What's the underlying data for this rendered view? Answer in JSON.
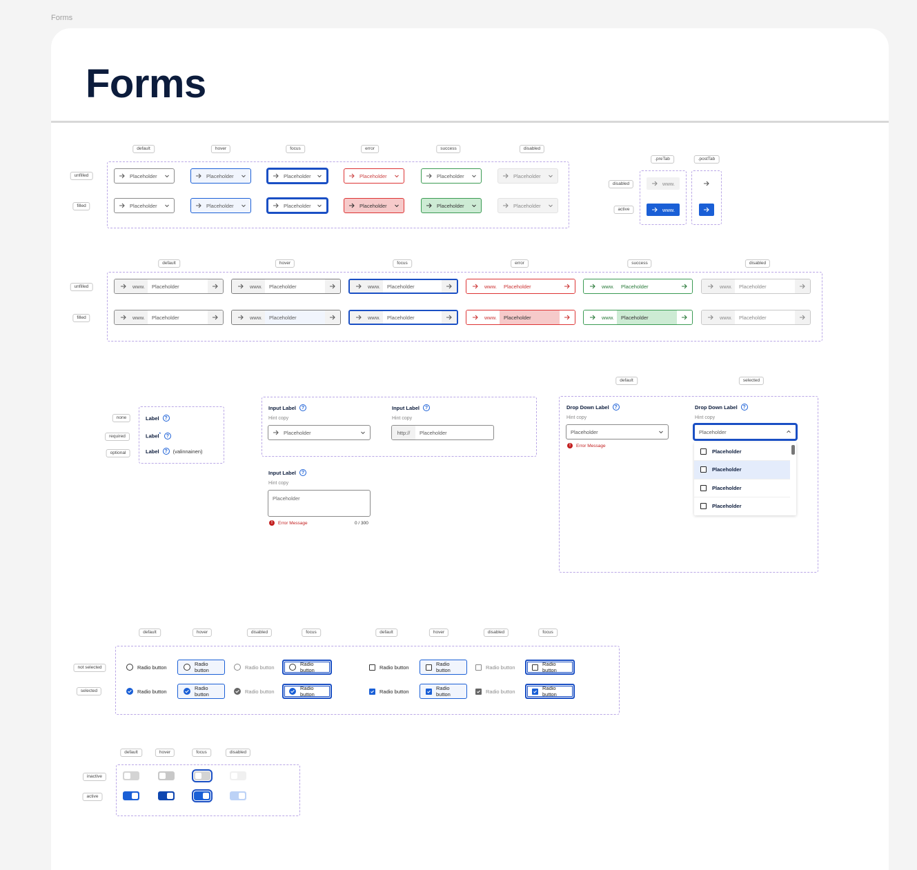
{
  "frame_label": "Forms",
  "page_title": "Forms",
  "state_tags": [
    "default",
    "hover",
    "focus",
    "error",
    "success",
    "disabled"
  ],
  "fill_tags": [
    "unfilled",
    "filled"
  ],
  "placeholder": "Placeholder",
  "url_prefix": "www.",
  "http_prefix": "http://",
  "tab_section": {
    "pre_tab": ".preTab",
    "post_tab": ".postTab",
    "disabled": "disabled",
    "active": "active"
  },
  "label_section": {
    "tags": [
      "none",
      "required",
      "optional"
    ],
    "label": "Label",
    "required_mark": "*",
    "optional_text": "(valinnainen)"
  },
  "inputs": {
    "input_label": "Input Label",
    "hint": "Hint copy",
    "error_message": "Error Message",
    "counter": "0 / 300"
  },
  "dropdown": {
    "tags": [
      "default",
      "selected"
    ],
    "label": "Drop Down Label",
    "hint": "Hint copy",
    "error_message": "Error Message",
    "options": [
      "Placeholder",
      "Placeholder",
      "Placeholder",
      "Placeholder"
    ]
  },
  "radio_section": {
    "tags": [
      "default",
      "hover",
      "disabled",
      "focus"
    ],
    "row_tags": [
      "not selected",
      "selected"
    ],
    "label": "Radio button"
  },
  "toggle_section": {
    "tags": [
      "default",
      "hover",
      "focus",
      "disabled"
    ],
    "row_tags": [
      "inactive",
      "active"
    ]
  },
  "colors": {
    "accent": "#1a5fd6",
    "error": "#d33333",
    "success": "#3a9a52",
    "title": "#0c1c3c"
  }
}
